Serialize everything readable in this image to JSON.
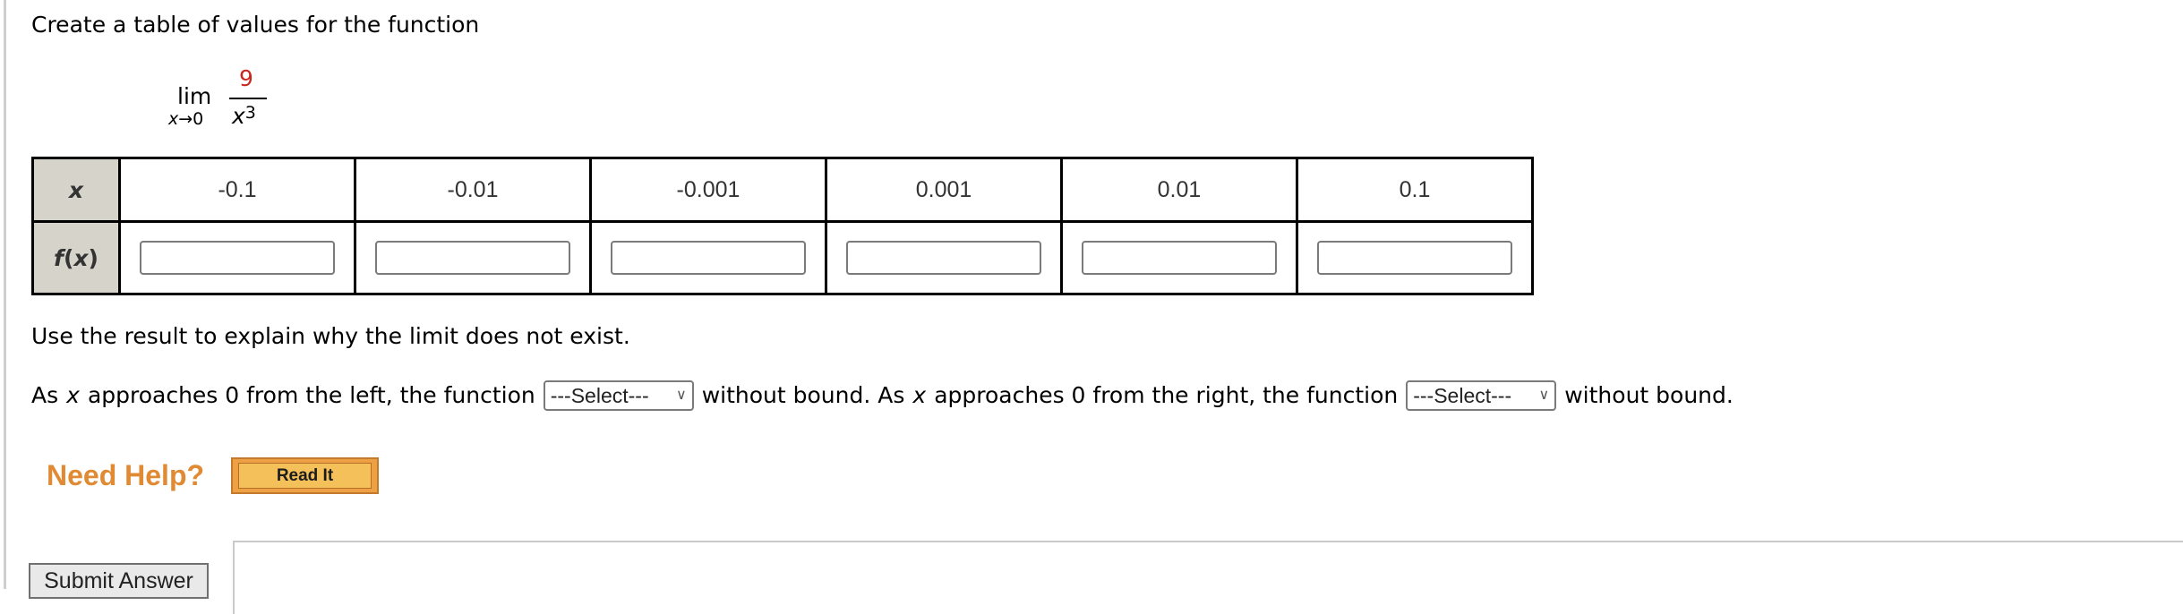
{
  "question": {
    "prompt": "Create a table of values for the function",
    "expression": {
      "operator": "lim",
      "subscript_var": "x",
      "subscript_arrow": "→",
      "subscript_target": "0",
      "numerator": "9",
      "denominator_base": "x",
      "denominator_exponent": "3",
      "numerator_color": "#c8281e"
    }
  },
  "table": {
    "row_headers": {
      "x": "x",
      "fx_f": "f",
      "fx_open": "(",
      "fx_var": "x",
      "fx_close": ")"
    },
    "x_values": [
      "-0.1",
      "-0.01",
      "-0.001",
      "0.001",
      "0.01",
      "0.1"
    ],
    "fx_inputs": [
      "",
      "",
      "",
      "",
      "",
      ""
    ],
    "header_bg": "#d6d3cb"
  },
  "explanation": {
    "instruction": "Use the result to explain why the limit does not exist.",
    "part1_pre_a": "As",
    "part1_var": "x",
    "part1_pre_b": "approaches 0 from the left, the function",
    "select1_value": "---Select---",
    "part1_post": "without bound. As",
    "part2_var": "x",
    "part2_pre": "approaches 0 from the right, the function",
    "select2_value": "---Select---",
    "part2_post": "without bound."
  },
  "help": {
    "label": "Need Help?",
    "read_it_label": "Read It",
    "accent": "#e08a33"
  },
  "actions": {
    "submit_label": "Submit Answer"
  }
}
